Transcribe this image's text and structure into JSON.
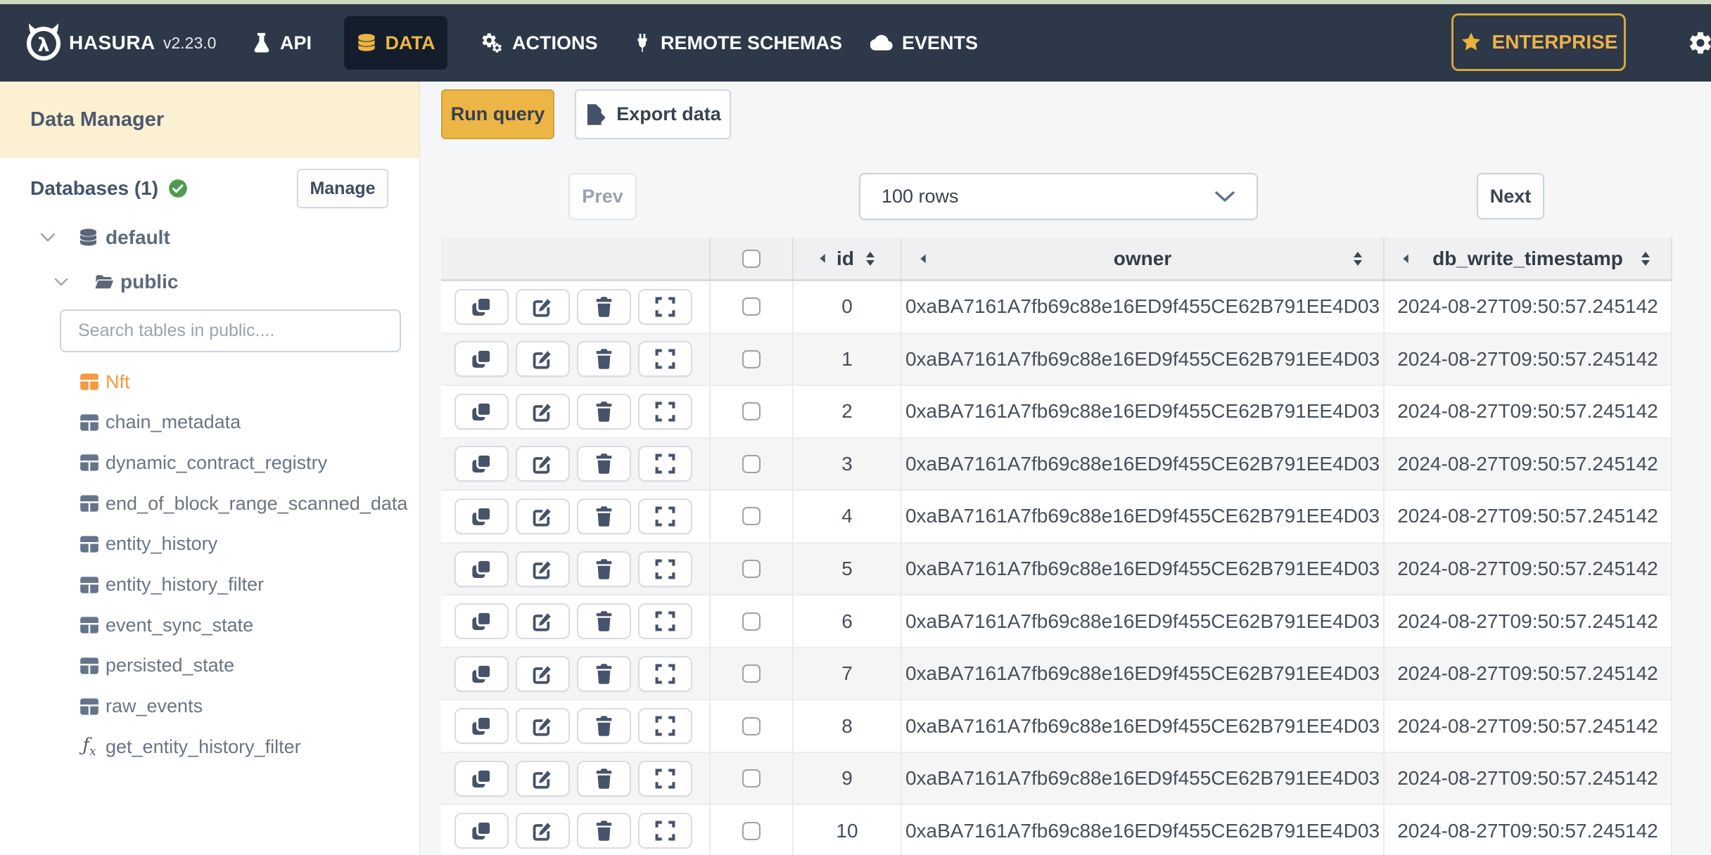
{
  "topbar": {
    "brand": "HASURA",
    "version": "v2.23.0",
    "nav": [
      {
        "label": "API",
        "icon": "flask"
      },
      {
        "label": "DATA",
        "icon": "database",
        "active": true
      },
      {
        "label": "ACTIONS",
        "icon": "gears"
      },
      {
        "label": "REMOTE SCHEMAS",
        "icon": "plug"
      },
      {
        "label": "EVENTS",
        "icon": "cloud"
      }
    ],
    "enterprise_label": "ENTERPRISE"
  },
  "sidebar": {
    "title": "Data Manager",
    "databases_label": "Databases (1)",
    "manage_label": "Manage",
    "tree": {
      "database": "default",
      "schema": "public"
    },
    "search_placeholder": "Search tables in public....",
    "tables": [
      {
        "label": "Nft",
        "type": "table",
        "highlight": true
      },
      {
        "label": "chain_metadata",
        "type": "table"
      },
      {
        "label": "dynamic_contract_registry",
        "type": "table"
      },
      {
        "label": "end_of_block_range_scanned_data",
        "type": "table"
      },
      {
        "label": "entity_history",
        "type": "table"
      },
      {
        "label": "entity_history_filter",
        "type": "table"
      },
      {
        "label": "event_sync_state",
        "type": "table"
      },
      {
        "label": "persisted_state",
        "type": "table"
      },
      {
        "label": "raw_events",
        "type": "table"
      },
      {
        "label": "get_entity_history_filter",
        "type": "function"
      }
    ]
  },
  "toolbar": {
    "run_query": "Run query",
    "export_data": "Export data"
  },
  "pager": {
    "prev": "Prev",
    "page_size": "100 rows",
    "next": "Next"
  },
  "table": {
    "columns": [
      "id",
      "owner",
      "db_write_timestamp"
    ],
    "rows": [
      {
        "id": "0",
        "owner": "0xaBA7161A7fb69c88e16ED9f455CE62B791EE4D03",
        "db_write_timestamp": "2024-08-27T09:50:57.245142"
      },
      {
        "id": "1",
        "owner": "0xaBA7161A7fb69c88e16ED9f455CE62B791EE4D03",
        "db_write_timestamp": "2024-08-27T09:50:57.245142"
      },
      {
        "id": "2",
        "owner": "0xaBA7161A7fb69c88e16ED9f455CE62B791EE4D03",
        "db_write_timestamp": "2024-08-27T09:50:57.245142"
      },
      {
        "id": "3",
        "owner": "0xaBA7161A7fb69c88e16ED9f455CE62B791EE4D03",
        "db_write_timestamp": "2024-08-27T09:50:57.245142"
      },
      {
        "id": "4",
        "owner": "0xaBA7161A7fb69c88e16ED9f455CE62B791EE4D03",
        "db_write_timestamp": "2024-08-27T09:50:57.245142"
      },
      {
        "id": "5",
        "owner": "0xaBA7161A7fb69c88e16ED9f455CE62B791EE4D03",
        "db_write_timestamp": "2024-08-27T09:50:57.245142"
      },
      {
        "id": "6",
        "owner": "0xaBA7161A7fb69c88e16ED9f455CE62B791EE4D03",
        "db_write_timestamp": "2024-08-27T09:50:57.245142"
      },
      {
        "id": "7",
        "owner": "0xaBA7161A7fb69c88e16ED9f455CE62B791EE4D03",
        "db_write_timestamp": "2024-08-27T09:50:57.245142"
      },
      {
        "id": "8",
        "owner": "0xaBA7161A7fb69c88e16ED9f455CE62B791EE4D03",
        "db_write_timestamp": "2024-08-27T09:50:57.245142"
      },
      {
        "id": "9",
        "owner": "0xaBA7161A7fb69c88e16ED9f455CE62B791EE4D03",
        "db_write_timestamp": "2024-08-27T09:50:57.245142"
      },
      {
        "id": "10",
        "owner": "0xaBA7161A7fb69c88e16ED9f455CE62B791EE4D03",
        "db_write_timestamp": "2024-08-27T09:50:57.245142"
      }
    ]
  },
  "colors": {
    "navbar_bg": "#2d3848",
    "active_tab_bg": "#131d2b",
    "accent_gold": "#ecb545",
    "sidebar_header_bg": "#fcf0d2",
    "table_highlight": "#f6993f",
    "row_alt_bg": "#f5f5f6"
  }
}
